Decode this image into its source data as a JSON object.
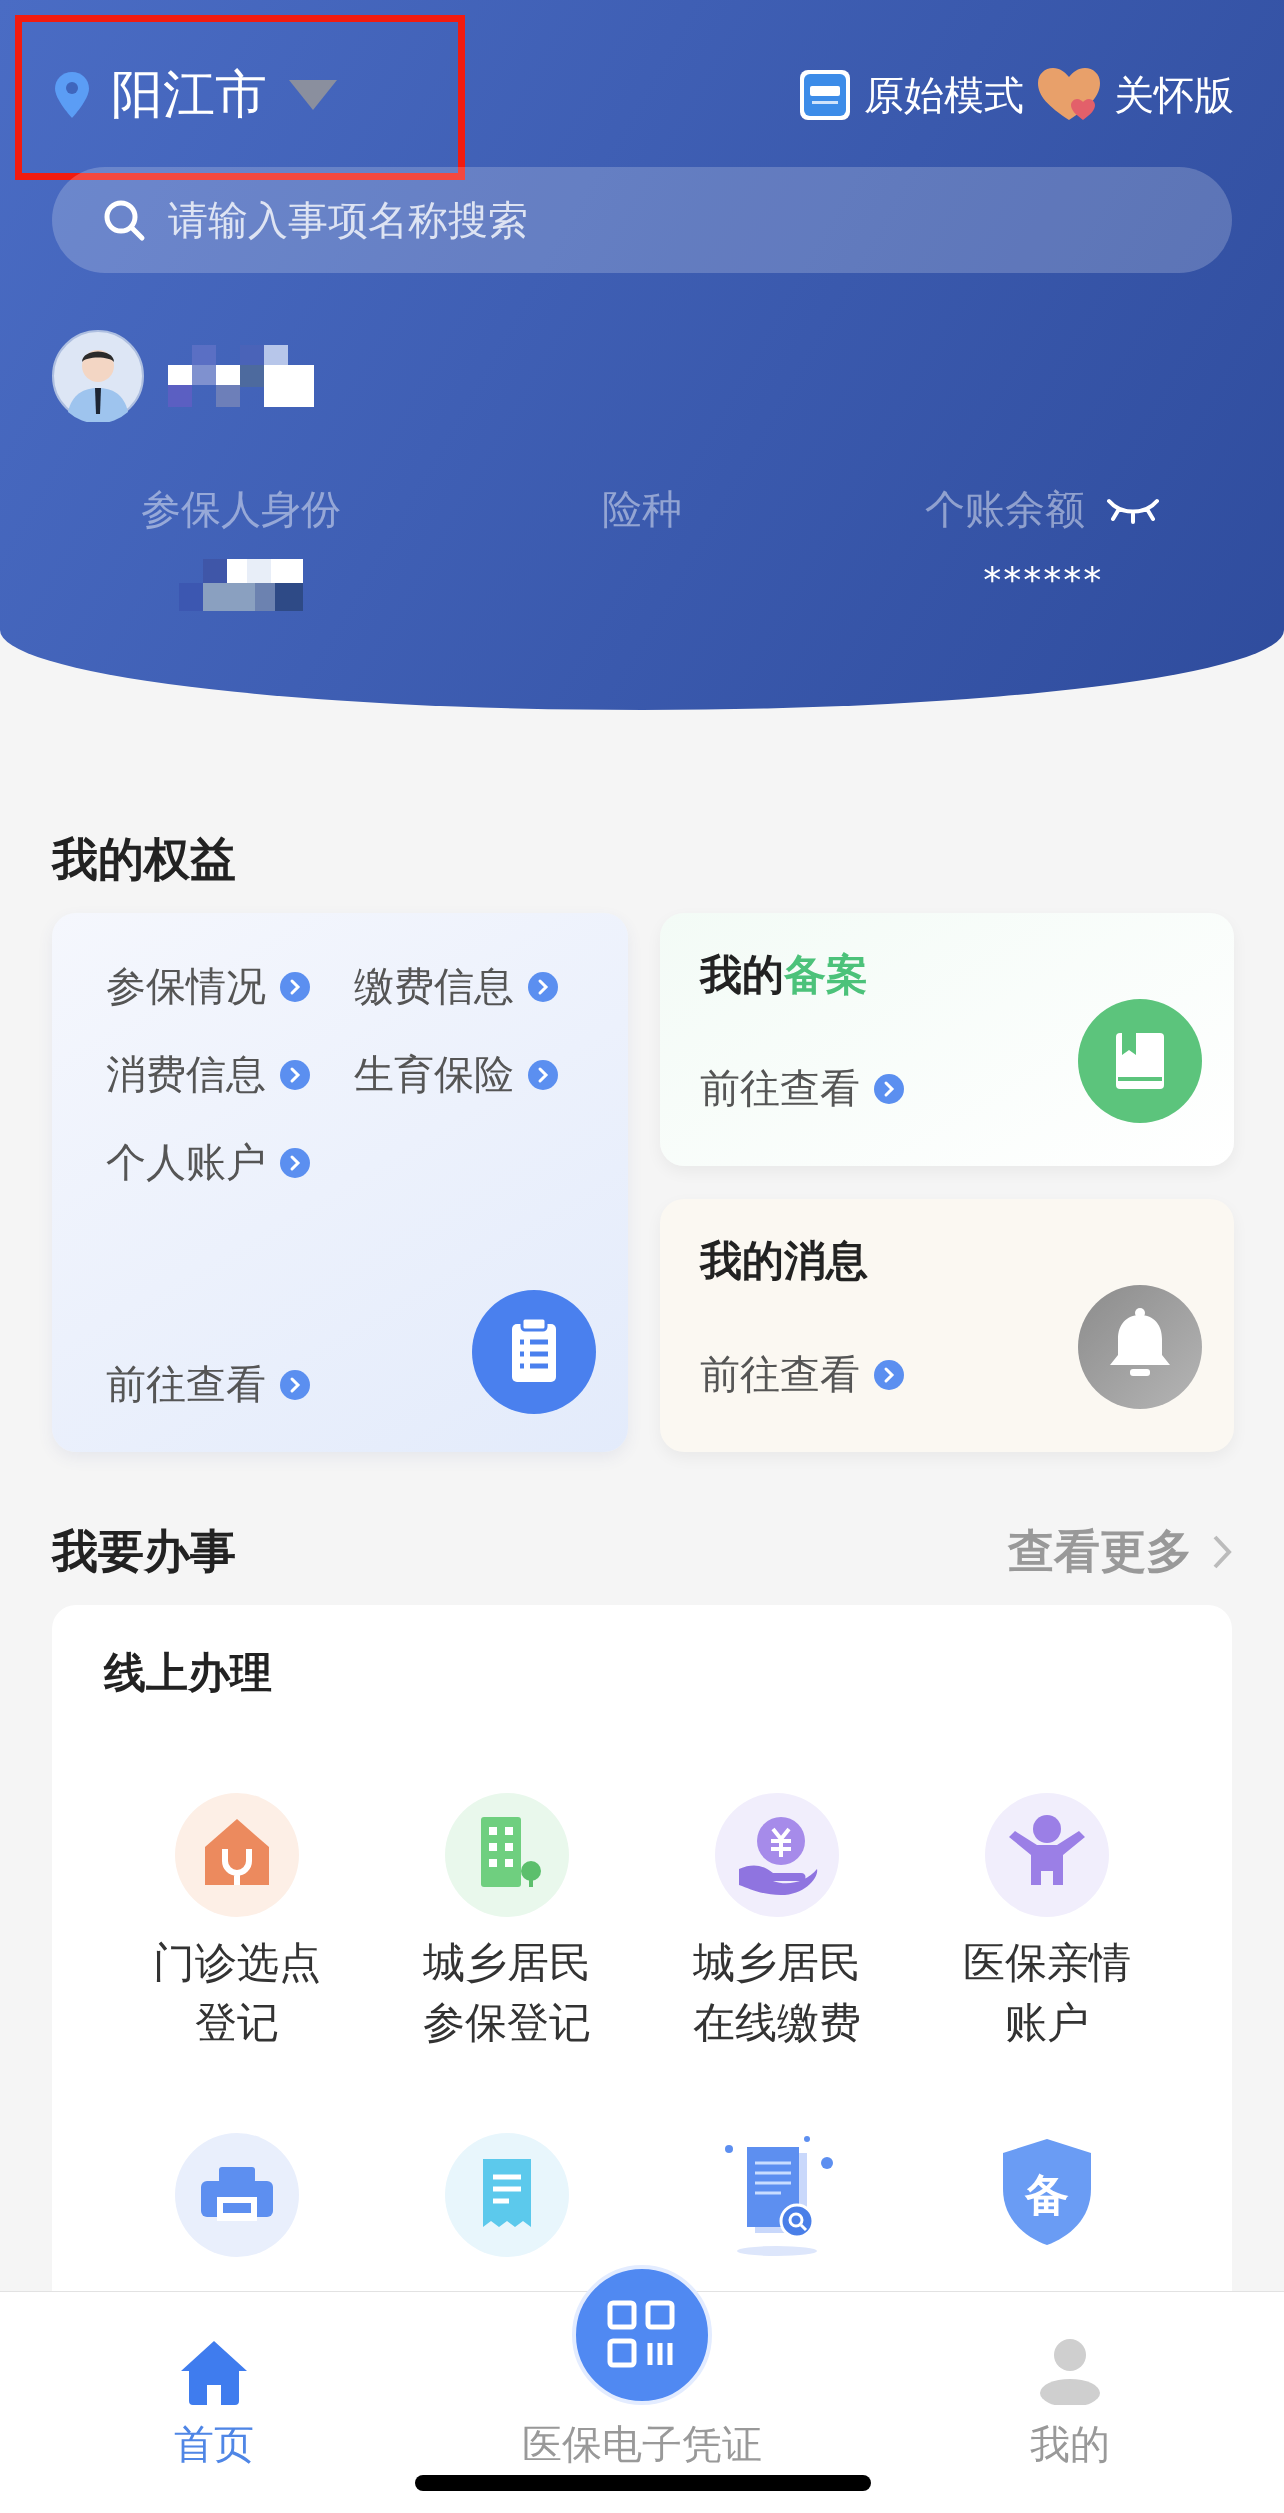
{
  "header": {
    "location": "阳江市",
    "mode_button": "原始模式",
    "care_button": "关怀版",
    "search": {
      "placeholder": "请输入事项名称搜索"
    },
    "profile": {
      "name_redacted": true
    },
    "stats": [
      {
        "label": "参保人身份",
        "value_redacted": true
      },
      {
        "label": "险种",
        "value_redacted": false
      },
      {
        "label": "个账余额",
        "value": "******",
        "hidden": true
      }
    ]
  },
  "rights": {
    "title": "我的权益",
    "main_card": {
      "links": [
        "参保情况",
        "缴费信息",
        "消费信息",
        "生育保险",
        "个人账户"
      ],
      "action": "前往查看"
    },
    "side_cards": [
      {
        "kind": "filing",
        "title": "我的",
        "title_accent": "备案",
        "action": "前往查看"
      },
      {
        "kind": "messages",
        "title": "我的消息",
        "action": "前往查看"
      }
    ]
  },
  "services": {
    "title": "我要办事",
    "more": "查看更多",
    "card_title": "线上办理",
    "items": [
      {
        "kind": "clinic",
        "label": "门诊选点登记"
      },
      {
        "kind": "building",
        "label": "城乡居民参保登记"
      },
      {
        "kind": "payment",
        "label": "城乡居民在线缴费"
      },
      {
        "kind": "family",
        "label": "医保亲情账户"
      },
      {
        "kind": "printer"
      },
      {
        "kind": "receipt"
      },
      {
        "kind": "document-search"
      },
      {
        "kind": "shield",
        "badge": "备"
      }
    ]
  },
  "nav": [
    {
      "kind": "home",
      "label": "首页",
      "selected": true
    },
    {
      "kind": "qr",
      "label": "医保电子凭证",
      "selected": false
    },
    {
      "kind": "profile",
      "label": "我的",
      "selected": false
    }
  ]
}
